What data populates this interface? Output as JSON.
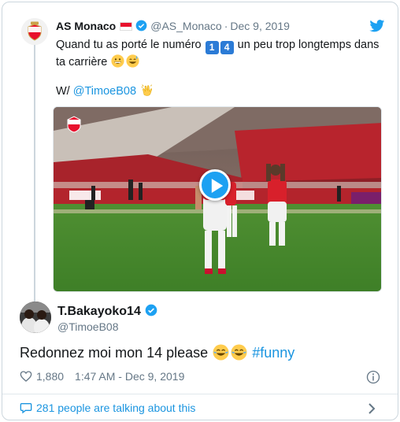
{
  "colors": {
    "link": "#1b95e0",
    "verified": "#1da1f2",
    "muted": "#657786",
    "monaco_red": "#e8112d"
  },
  "parent": {
    "name": "AS Monaco",
    "handle": "@AS_Monaco",
    "separator": "·",
    "date": "Dec 9, 2019",
    "text_1": "Quand tu as porté le numéro",
    "key1": "1",
    "key2": "4",
    "text_2": "un peu trop longtemps dans ta carrière",
    "w_prefix": "W/",
    "w_mention": "@TimoeB08",
    "avatar_icon": "monaco-crest-icon"
  },
  "video": {
    "play_icon": "play-icon"
  },
  "tweet": {
    "name": "T.Bakayoko14",
    "handle": "@TimoeB08",
    "text": "Redonnez moi mon 14 please",
    "hashtag": "#funny",
    "likes": "1,880",
    "time": "1:47 AM - Dec 9, 2019"
  },
  "footer": {
    "label": "281 people are talking about this"
  }
}
